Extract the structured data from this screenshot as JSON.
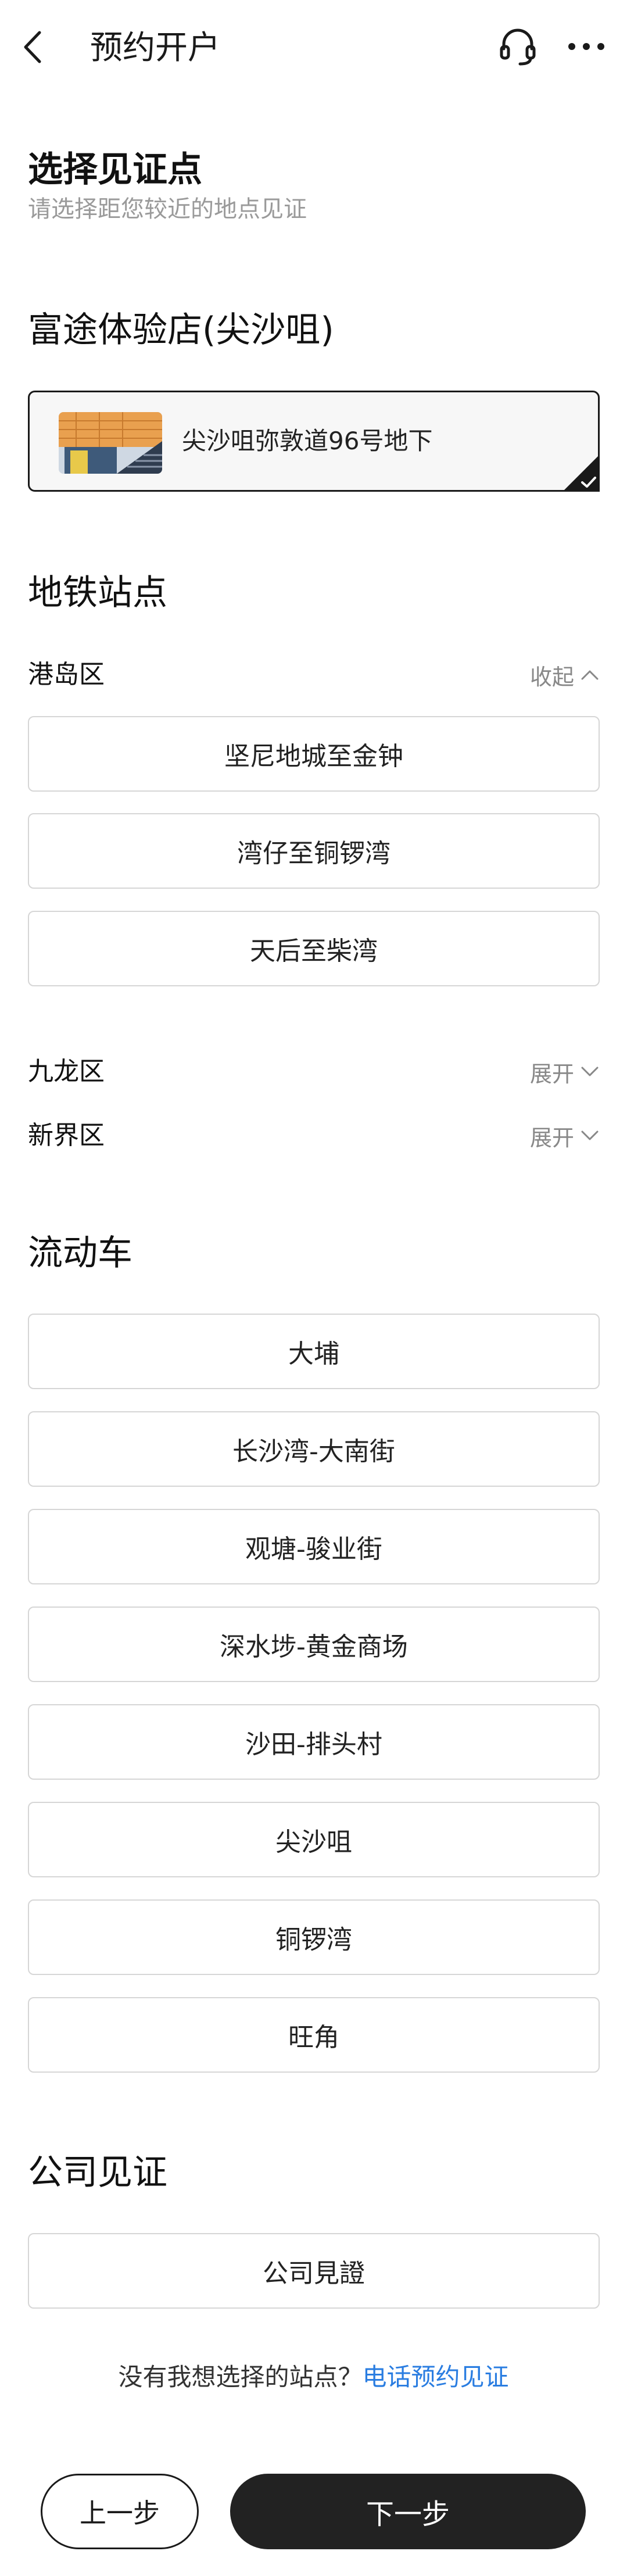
{
  "header": {
    "title": "预约开户"
  },
  "witness": {
    "title": "选择见证点",
    "subtitle": "请选择距您较近的地点见证"
  },
  "store": {
    "title": "富途体验店(尖沙咀)",
    "selected_label": "尖沙咀弥敦道96号地下"
  },
  "metro": {
    "title": "地铁站点",
    "regions": [
      {
        "name": "港岛区",
        "toggle": "收起",
        "expanded": true
      },
      {
        "name": "九龙区",
        "toggle": "展开",
        "expanded": false
      },
      {
        "name": "新界区",
        "toggle": "展开",
        "expanded": false
      }
    ],
    "hk_island_options": [
      "坚尼地城至金钟",
      "湾仔至铜锣湾",
      "天后至柴湾"
    ]
  },
  "mobile": {
    "title": "流动车",
    "options": [
      "大埔",
      "长沙湾-大南街",
      "观塘-骏业街",
      "深水埗-黄金商场",
      "沙田-排头村",
      "尖沙咀",
      "铜锣湾",
      "旺角"
    ]
  },
  "company": {
    "title": "公司见证",
    "option": "公司見證"
  },
  "footer": {
    "note": "没有我想选择的站点？",
    "link": "电话预约见证",
    "prev_label": "上一步",
    "next_label": "下一步"
  },
  "colors": {
    "link": "#2a7de1",
    "primary_button": "#222222",
    "selected_border": "#1a1a1a"
  }
}
